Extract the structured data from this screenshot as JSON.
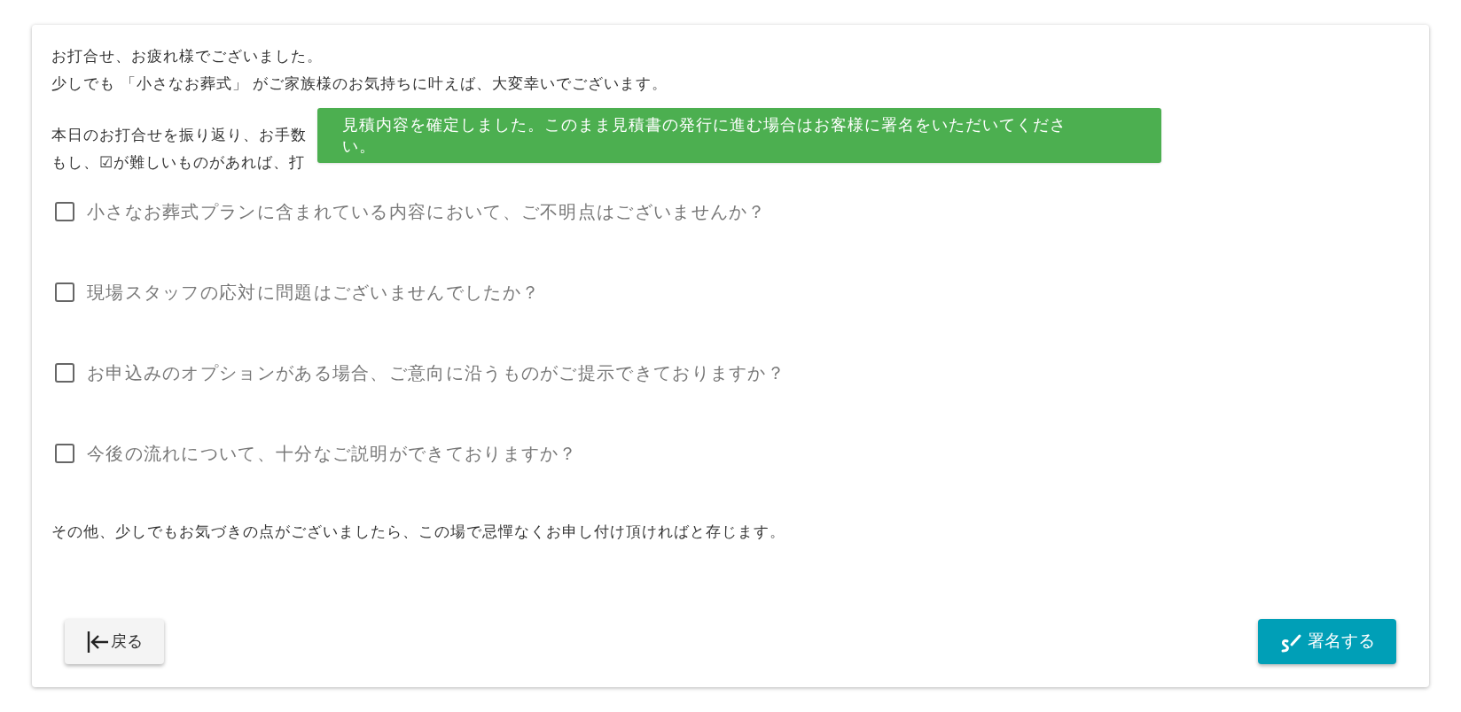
{
  "intro_lines": [
    "お打合せ、お疲れ様でございました。",
    "少しでも 「小さなお葬式」 がご家族様のお気持ちに叶えば、大変幸いでございます。"
  ],
  "review_lines": [
    "本日のお打合せを振り返り、お手数",
    "もし、☑が難しいものがあれば、打"
  ],
  "checklist": [
    {
      "label": "小さなお葬式プランに含まれている内容において、ご不明点はございませんか？",
      "checked": false
    },
    {
      "label": "現場スタッフの応対に問題はございませんでしたか？",
      "checked": false
    },
    {
      "label": "お申込みのオプションがある場合、ご意向に沿うものがご提示できておりますか？",
      "checked": false
    },
    {
      "label": "今後の流れについて、十分なご説明ができておりますか？",
      "checked": false
    }
  ],
  "closing": "その他、少しでもお気づきの点がございましたら、この場で忌憚なくお申し付け頂ければと存じます。",
  "back_button": "戻る",
  "sign_button": "署名する",
  "toast": "見積内容を確定しました。このまま見積書の発行に進む場合はお客様に署名をいただいてください。"
}
